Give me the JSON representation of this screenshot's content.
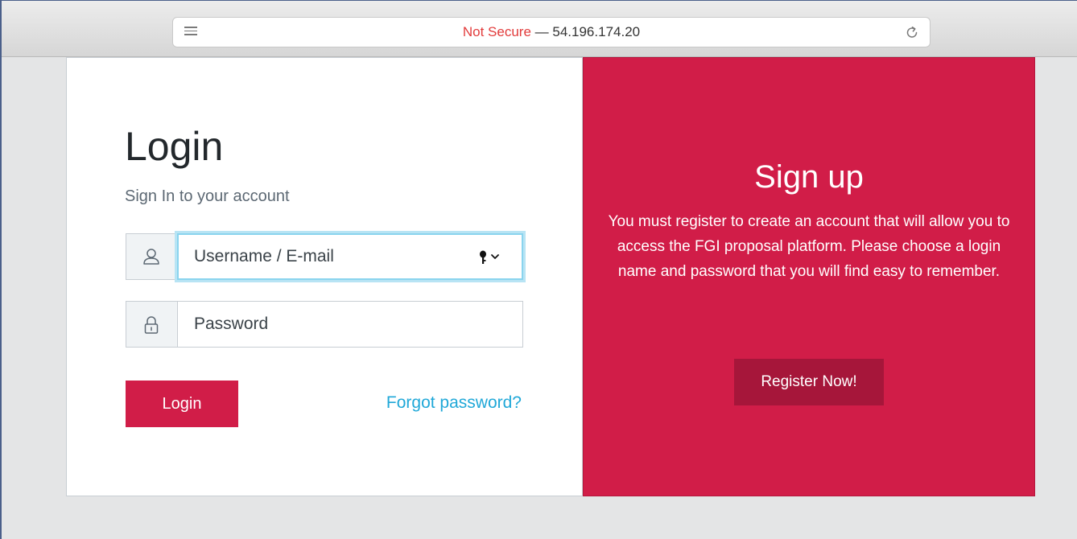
{
  "browser": {
    "security_label": "Not Secure",
    "separator": "—",
    "address": "54.196.174.20",
    "icons": {
      "reader": "reader-lines-icon",
      "reload": "reload-icon"
    }
  },
  "login": {
    "title": "Login",
    "subtitle": "Sign In to your account",
    "username_placeholder": "Username / E-mail",
    "password_placeholder": "Password",
    "login_button": "Login",
    "forgot_link": "Forgot password?",
    "icons": {
      "username": "user-icon",
      "password": "lock-icon",
      "keychain": "key-icon"
    }
  },
  "signup": {
    "title": "Sign up",
    "text": "You must register to create an account that will allow you to access the FGI proposal platform. Please choose a login name and password that you will find easy to remember.",
    "register_button": "Register Now!"
  },
  "colors": {
    "accent": "#d11d48",
    "register_button": "#a6163a",
    "link": "#20a8d8",
    "not_secure": "#e23b3b",
    "page_background": "#e4e5e6"
  }
}
